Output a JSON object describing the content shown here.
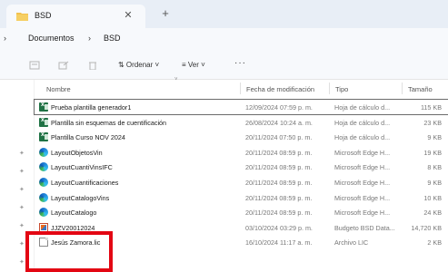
{
  "window": {
    "tab_title": "BSD",
    "tab_close": "✕",
    "tab_new": "+"
  },
  "address": {
    "chevron": "›",
    "crumbs": [
      "Documentos",
      "BSD"
    ],
    "separator": "›"
  },
  "toolbar": {
    "sort_label": "⇅ Ordenar ˅",
    "view_label": "≡ Ver ˅",
    "more_label": "···"
  },
  "columns": {
    "name": "Nombre",
    "date": "Fecha de modificación",
    "type": "Tipo",
    "size": "Tamaño"
  },
  "files": [
    {
      "icon": "excel-icon",
      "name": "Prueba plantilla generador1",
      "date": "12/09/2024 07:59 p. m.",
      "type": "Hoja de cálculo d...",
      "size": "115 KB",
      "selected": true
    },
    {
      "icon": "excel-icon",
      "name": "Plantilla sin esquemas de cuentificación",
      "date": "26/08/2024 10:24 a. m.",
      "type": "Hoja de cálculo d...",
      "size": "23 KB"
    },
    {
      "icon": "excel-icon",
      "name": "Plantilla Curso NOV 2024",
      "date": "20/11/2024 07:50 p. m.",
      "type": "Hoja de cálculo d...",
      "size": "9 KB"
    },
    {
      "icon": "edge-icon",
      "name": "LayoutObjetosVin",
      "date": "20/11/2024 08:59 p. m.",
      "type": "Microsoft Edge H...",
      "size": "19 KB"
    },
    {
      "icon": "edge-icon",
      "name": "LayoutCuantiVinsIFC",
      "date": "20/11/2024 08:59 p. m.",
      "type": "Microsoft Edge H...",
      "size": "8 KB"
    },
    {
      "icon": "edge-icon",
      "name": "LayoutCuantificaciones",
      "date": "20/11/2024 08:59 p. m.",
      "type": "Microsoft Edge H...",
      "size": "9 KB"
    },
    {
      "icon": "edge-icon",
      "name": "LayoutCatalogoVins",
      "date": "20/11/2024 08:59 p. m.",
      "type": "Microsoft Edge H...",
      "size": "10 KB"
    },
    {
      "icon": "edge-icon",
      "name": "LayoutCatalogo",
      "date": "20/11/2024 08:59 p. m.",
      "type": "Microsoft Edge H...",
      "size": "24 KB"
    },
    {
      "icon": "bsd-data-icon",
      "name": "JJZV20012024",
      "date": "03/10/2024 03:29 p. m.",
      "type": "Budgeto BSD Data...",
      "size": "14,720 KB"
    },
    {
      "icon": "lic-file-icon",
      "name": "Jesús Zamora.lic",
      "date": "16/10/2024 11:17 a. m.",
      "type": "Archivo LIC",
      "size": "2 KB"
    }
  ],
  "colors": {
    "highlight": "#e30613",
    "selection_outline": "#6b6b6b",
    "excel_green": "#1f7244"
  }
}
